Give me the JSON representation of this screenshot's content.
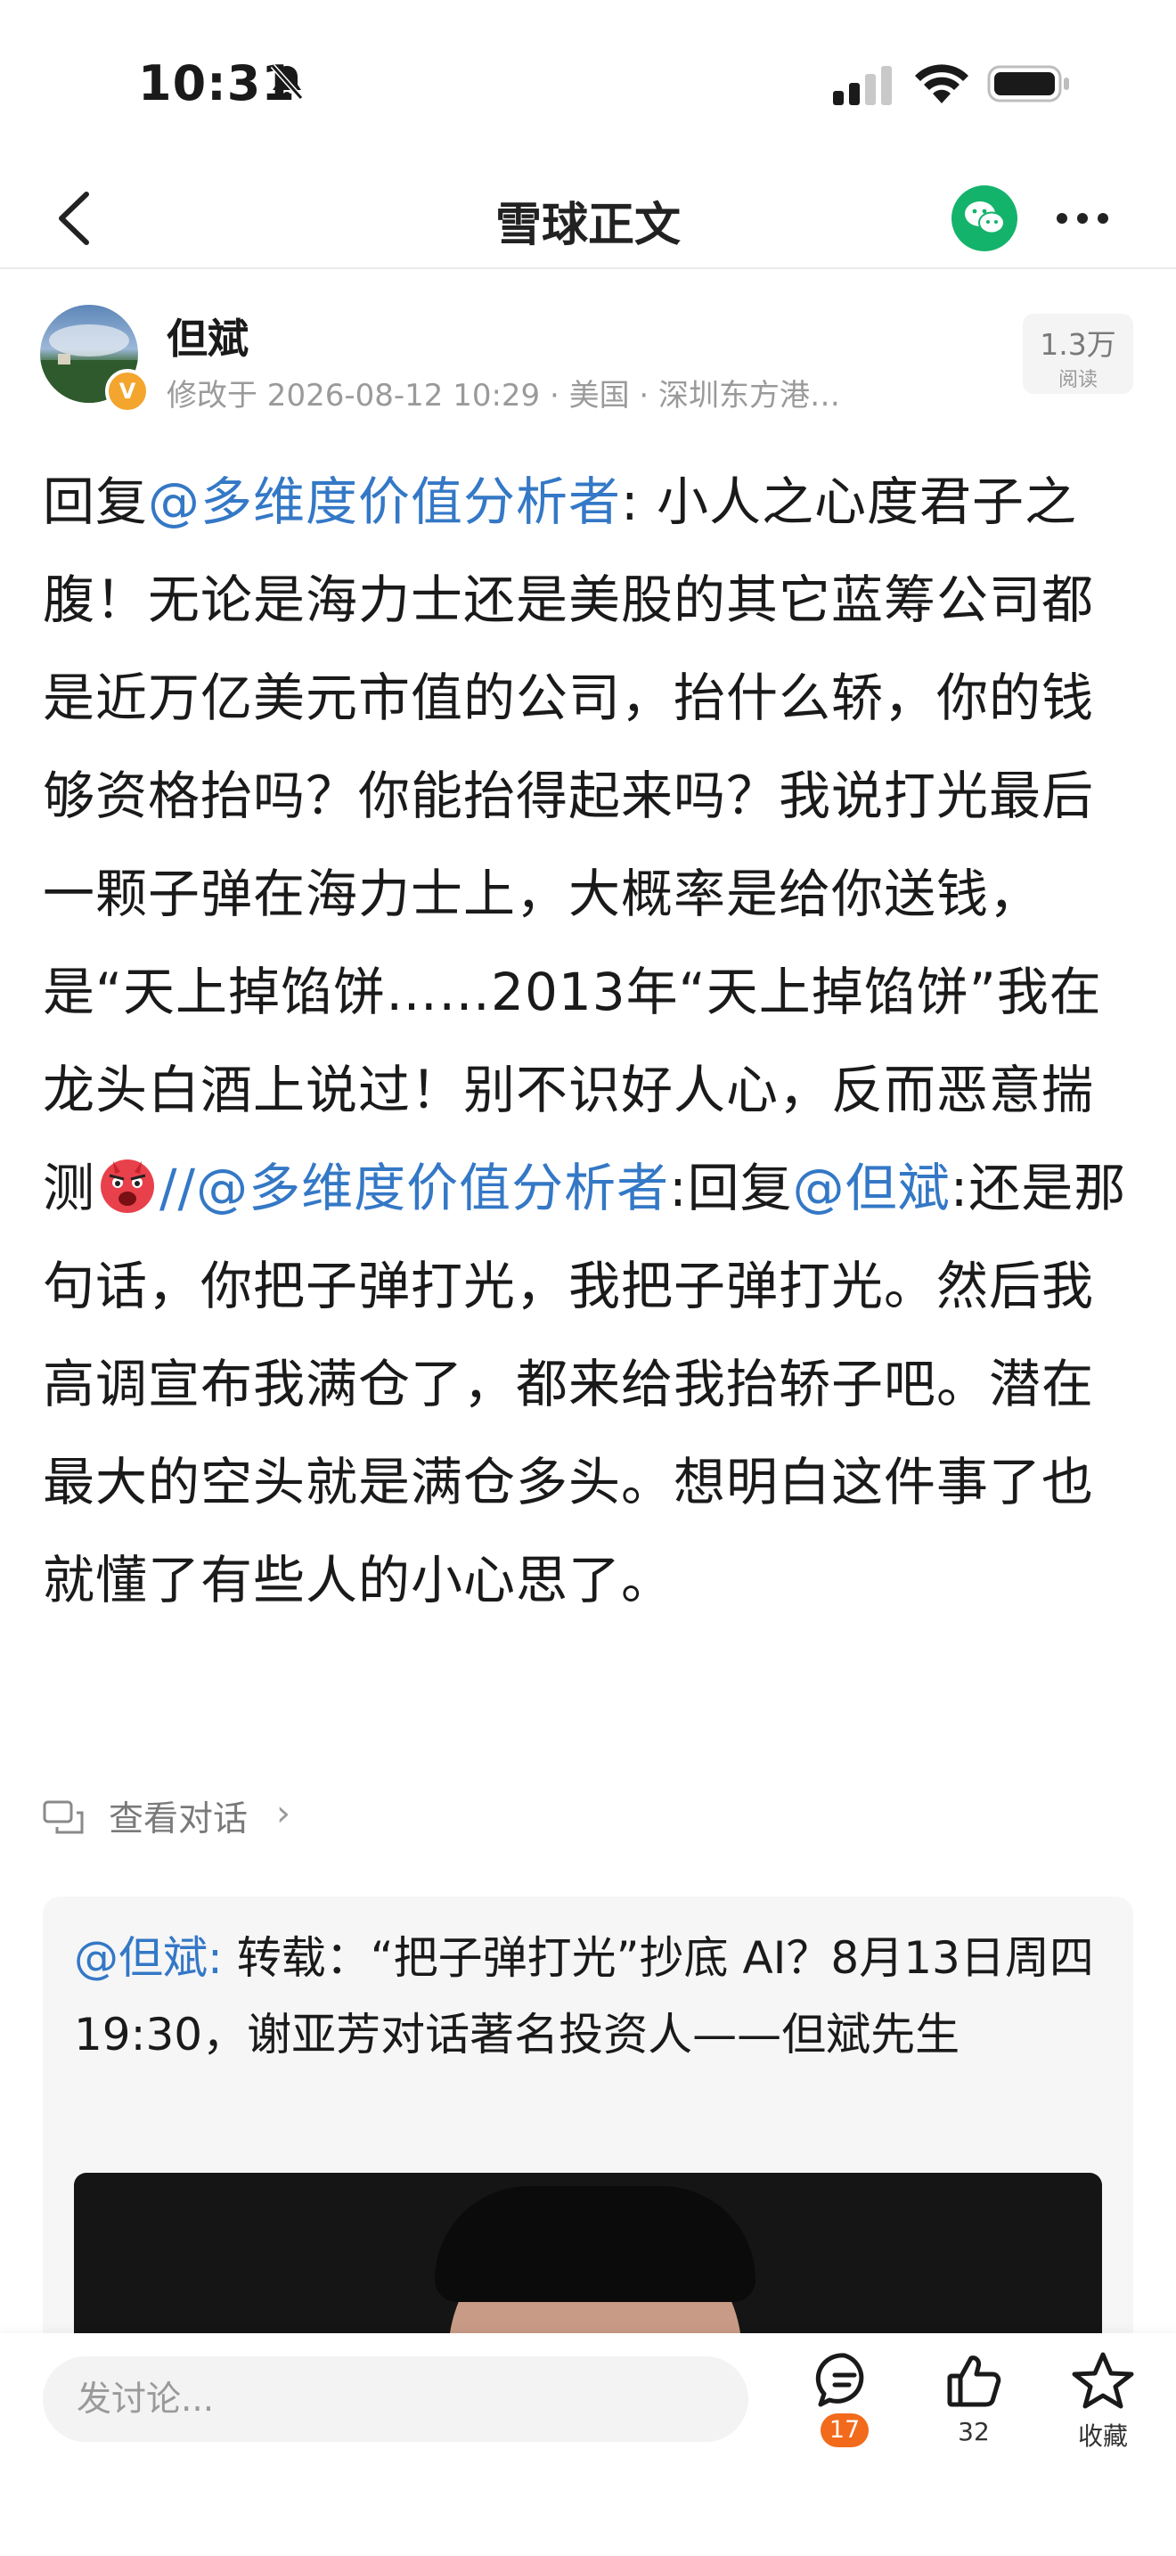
{
  "status_bar": {
    "time": "10:31"
  },
  "nav": {
    "title": "雪球正文"
  },
  "author": {
    "name": "但斌",
    "badge": "V",
    "meta": "修改于 2026-08-12 10:29 · 美国 · 深圳东方港…",
    "views_count": "1.3万",
    "views_label": "阅读"
  },
  "post": {
    "prefix": "回复",
    "mention1": "@多维度价值分析者",
    "text1": ": 小人之心度君子之腹！无论是海力士还是美股的其它蓝筹公司都是近万亿美元市值的公司，抬什么轿，你的钱够资格抬吗？你能抬得起来吗？我说打光最后一颗子弹在海力士上，大概率是给你送钱，是“天上掉馅饼……2013年“天上掉馅饼”我在龙头白酒上说过！别不识好人心，反而恶意揣测",
    "sep": "//",
    "mention2": "@多维度价值分析者",
    "text2": ":回复",
    "mention3": "@但斌",
    "text3": ":还是那句话，你把子弹打光，我把子弹打光。然后我高调宣布我满仓了，都来给我抬轿子吧。潜在最大的空头就是满仓多头。想明白这件事了也就懂了有些人的小心思了。"
  },
  "conversation": {
    "label": "查看对话"
  },
  "quoted": {
    "mention": "@但斌:",
    "text": " 转载：“把子弹打光”抄底 AI？8月13日周四19:30，谢亚芳对话著名投资人——但斌先生"
  },
  "bottom": {
    "placeholder": "发讨论...",
    "comments": "17",
    "likes": "32",
    "favorite_label": "收藏"
  },
  "colors": {
    "accent": "#3478c6",
    "badge": "#f26a1b",
    "wechat": "#14b36b"
  }
}
